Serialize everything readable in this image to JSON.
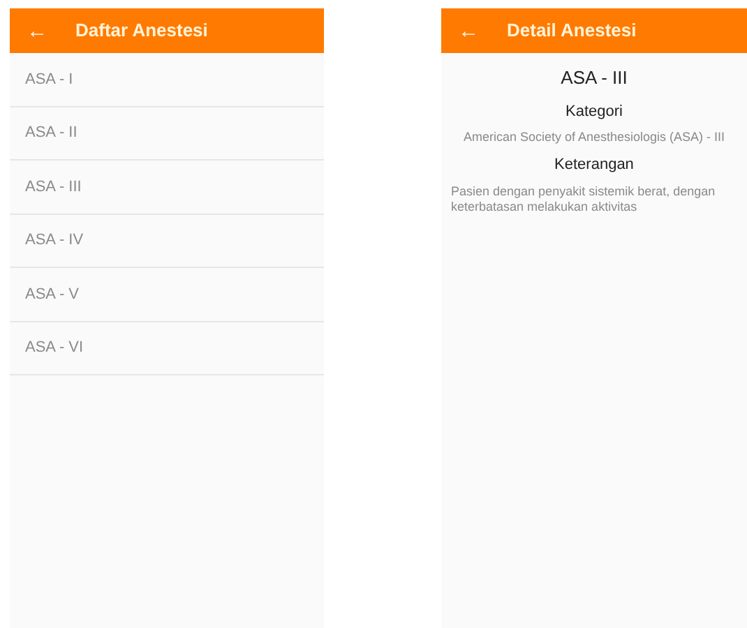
{
  "screens": [
    {
      "kind": "list",
      "header": {
        "back": "←",
        "title": "Daftar Anestesi"
      },
      "items": [
        "ASA - I",
        "ASA - II",
        "ASA - III",
        "ASA - IV",
        "ASA - V",
        "ASA - VI"
      ]
    },
    {
      "kind": "detail",
      "header": {
        "back": "←",
        "title": "Detail Anestesi"
      },
      "heading": "ASA - III",
      "sections": [
        {
          "label": "Kategori",
          "text": "American Society of Anesthesiologis (ASA) - III"
        },
        {
          "label": "Keterangan",
          "text": "Pasien dengan penyakit sistemik berat, dengan keterbatasan melakukan aktivitas"
        }
      ]
    }
  ]
}
